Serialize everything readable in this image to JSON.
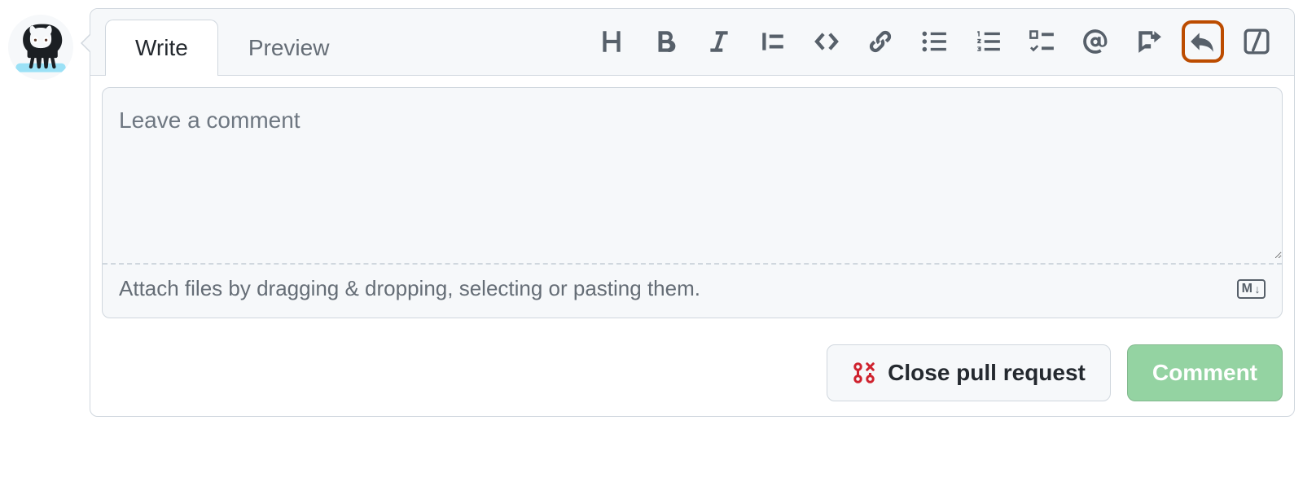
{
  "tabs": {
    "write": "Write",
    "preview": "Preview"
  },
  "toolbar": {
    "heading": "heading-icon",
    "bold": "bold-icon",
    "italic": "italic-icon",
    "quote": "quote-icon",
    "code": "code-icon",
    "link": "link-icon",
    "ul": "unordered-list-icon",
    "ol": "ordered-list-icon",
    "tasklist": "task-list-icon",
    "mention": "mention-icon",
    "crossref": "cross-reference-icon",
    "reply": "reply-icon",
    "slash": "slash-icon"
  },
  "comment": {
    "value": "",
    "placeholder": "Leave a comment",
    "attach_hint": "Attach files by dragging & dropping, selecting or pasting them.",
    "markdown_badge": "M"
  },
  "actions": {
    "close_label": "Close pull request",
    "comment_label": "Comment"
  }
}
